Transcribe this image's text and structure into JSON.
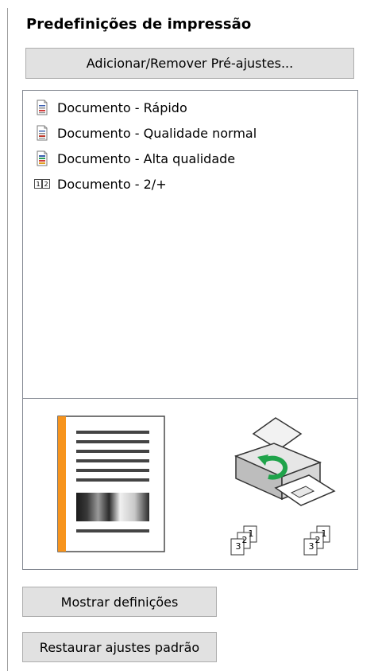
{
  "panel": {
    "title": "Predefinições de impressão",
    "add_remove_label": "Adicionar/Remover Pré-ajustes...",
    "presets": [
      {
        "label": "Documento - Rápido",
        "icon": "document-fast-icon"
      },
      {
        "label": "Documento - Qualidade normal",
        "icon": "document-normal-icon"
      },
      {
        "label": "Documento - Alta qualidade",
        "icon": "document-high-icon"
      },
      {
        "label": "Documento - 2/+",
        "icon": "two-up-icon",
        "icon_text": "12"
      }
    ],
    "preview": {
      "stack_numbers_left": [
        "1",
        "2",
        "3"
      ],
      "stack_numbers_right": [
        "1",
        "2",
        "3"
      ],
      "accent_color": "#f7941d",
      "rotate_arrow_color": "#1fa34a"
    },
    "show_settings_label": "Mostrar definições",
    "restore_defaults_label": "Restaurar ajustes padrão"
  }
}
